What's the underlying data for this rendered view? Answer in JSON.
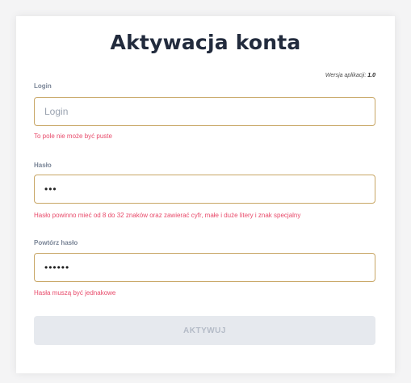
{
  "title": "Aktywacja konta",
  "version": {
    "label": "Wersja aplikacji:",
    "value": "1.0"
  },
  "login": {
    "label": "Login",
    "placeholder": "Login",
    "value": "",
    "error": "To pole nie może być puste"
  },
  "password": {
    "label": "Hasło",
    "value": "•••",
    "error": "Hasło powinno mieć od 8 do 32 znaków oraz zawierać cyfr, małe i duże litery i znak specjalny"
  },
  "repeat_password": {
    "label": "Powtórz hasło",
    "value": "••••••",
    "error": "Hasła muszą być jednakowe"
  },
  "submit": {
    "label": "AKTYWUJ"
  },
  "colors": {
    "title": "#222b3d",
    "field_border": "#c8a665",
    "error": "#e84a6a",
    "disabled_button": "#e6e9ee"
  }
}
